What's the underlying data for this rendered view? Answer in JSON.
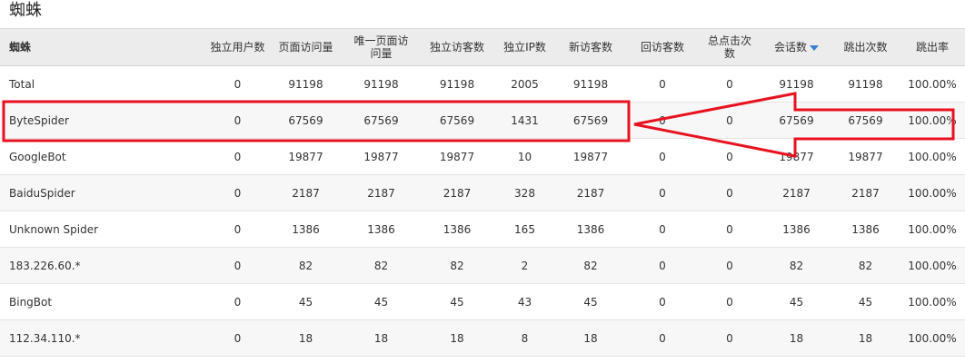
{
  "page_title": "蜘蛛",
  "colors": {
    "annotation": "#e8121f",
    "sort_arrow": "#3a7fd0",
    "header_bg": "#ececec"
  },
  "table": {
    "columns": [
      "蜘蛛",
      "独立用户数",
      "页面访问量",
      "唯一页面访问量",
      "独立访客数",
      "独立IP数",
      "新访客数",
      "回访客数",
      "总点击次数",
      "会话数",
      "跳出次数",
      "跳出率"
    ],
    "sorted_column": "会话数",
    "sort_direction": "descending",
    "rows": [
      [
        "Total",
        "0",
        "91198",
        "91198",
        "91198",
        "2005",
        "91198",
        "0",
        "0",
        "91198",
        "91198",
        "100.00%"
      ],
      [
        "ByteSpider",
        "0",
        "67569",
        "67569",
        "67569",
        "1431",
        "67569",
        "0",
        "0",
        "67569",
        "67569",
        "100.00%"
      ],
      [
        "GoogleBot",
        "0",
        "19877",
        "19877",
        "19877",
        "10",
        "19877",
        "0",
        "0",
        "19877",
        "19877",
        "100.00%"
      ],
      [
        "BaiduSpider",
        "0",
        "2187",
        "2187",
        "2187",
        "328",
        "2187",
        "0",
        "0",
        "2187",
        "2187",
        "100.00%"
      ],
      [
        "Unknown Spider",
        "0",
        "1386",
        "1386",
        "1386",
        "165",
        "1386",
        "0",
        "0",
        "1386",
        "1386",
        "100.00%"
      ],
      [
        "183.226.60.*",
        "0",
        "82",
        "82",
        "82",
        "2",
        "82",
        "0",
        "0",
        "82",
        "82",
        "100.00%"
      ],
      [
        "BingBot",
        "0",
        "45",
        "45",
        "45",
        "43",
        "45",
        "0",
        "0",
        "45",
        "45",
        "100.00%"
      ],
      [
        "112.34.110.*",
        "0",
        "18",
        "18",
        "18",
        "8",
        "18",
        "0",
        "0",
        "18",
        "18",
        "100.00%"
      ]
    ]
  },
  "annotation": {
    "highlighted_row": "ByteSpider",
    "arrow_direction": "left"
  }
}
